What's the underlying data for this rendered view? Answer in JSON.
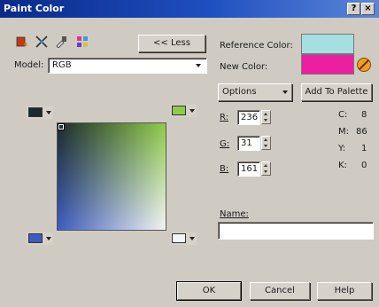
{
  "window": {
    "title": "Paint Color",
    "help_label": "?",
    "close_label": "×"
  },
  "toolbar": {
    "icons": [
      "paint-bucket-icon",
      "crosshair-icon",
      "eyedropper-icon",
      "palette-grid-icon"
    ],
    "less_label": "<< Less"
  },
  "model": {
    "label": "Model:",
    "value": "RGB"
  },
  "colors": {
    "reference_label": "Reference Color:",
    "reference_hex": "#a6dfe2",
    "new_label": "New Color:",
    "new_hex": "#ec1fa1"
  },
  "options_label": "Options",
  "add_to_palette_label": "Add To Palette",
  "rgb": [
    {
      "label": "R:",
      "value": "236"
    },
    {
      "label": "G:",
      "value": "31"
    },
    {
      "label": "B:",
      "value": "161"
    }
  ],
  "cmyk": [
    {
      "label": "C:",
      "value": "8"
    },
    {
      "label": "M:",
      "value": "86"
    },
    {
      "label": "Y:",
      "value": "1"
    },
    {
      "label": "K:",
      "value": "0"
    }
  ],
  "corner_swatches": {
    "top_left": "#1e2a2a",
    "top_right": "#8fcb4a",
    "bottom_left": "#3d5cc0",
    "bottom_right": "#f4f4f4"
  },
  "name": {
    "label": "Name:",
    "value": ""
  },
  "buttons": {
    "ok": "OK",
    "cancel": "Cancel",
    "help": "Help"
  }
}
